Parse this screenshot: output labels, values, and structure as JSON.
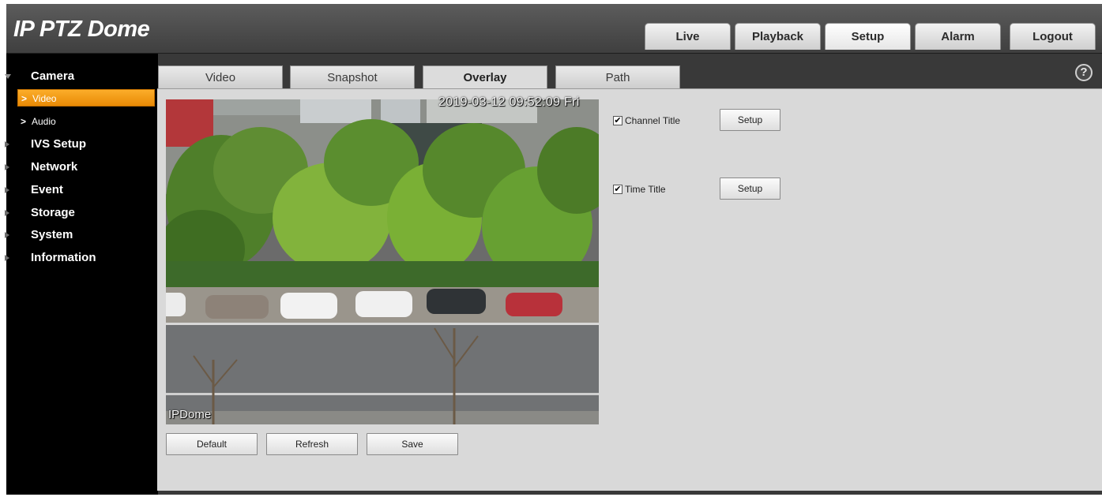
{
  "app": {
    "title": "IP PTZ Dome"
  },
  "top_nav": [
    {
      "label": "Live"
    },
    {
      "label": "Playback"
    },
    {
      "label": "Setup",
      "active": true
    },
    {
      "label": "Alarm"
    },
    {
      "label": "Logout"
    }
  ],
  "sidebar": {
    "sections": [
      {
        "label": "Camera",
        "expanded": true
      },
      {
        "label": "IVS Setup"
      },
      {
        "label": "Network"
      },
      {
        "label": "Event"
      },
      {
        "label": "Storage"
      },
      {
        "label": "System"
      },
      {
        "label": "Information"
      }
    ],
    "camera_items": [
      {
        "label": "Video",
        "active": true
      },
      {
        "label": "Audio"
      }
    ],
    "accent": "#f39c12"
  },
  "tabs": [
    {
      "label": "Video"
    },
    {
      "label": "Snapshot"
    },
    {
      "label": "Overlay",
      "active": true
    },
    {
      "label": "Path"
    }
  ],
  "help_icon": "?",
  "preview": {
    "time_osd": "2019-03-12 09:52:09 Fri",
    "channel_osd": "IPDome"
  },
  "overlay": {
    "channel_title": {
      "label": "Channel Title",
      "checked": true,
      "mark": "✔",
      "button": "Setup"
    },
    "time_title": {
      "label": "Time Title",
      "checked": true,
      "mark": "✔",
      "button": "Setup"
    }
  },
  "actions": {
    "default_label": "Default",
    "refresh_label": "Refresh",
    "save_label": "Save"
  }
}
